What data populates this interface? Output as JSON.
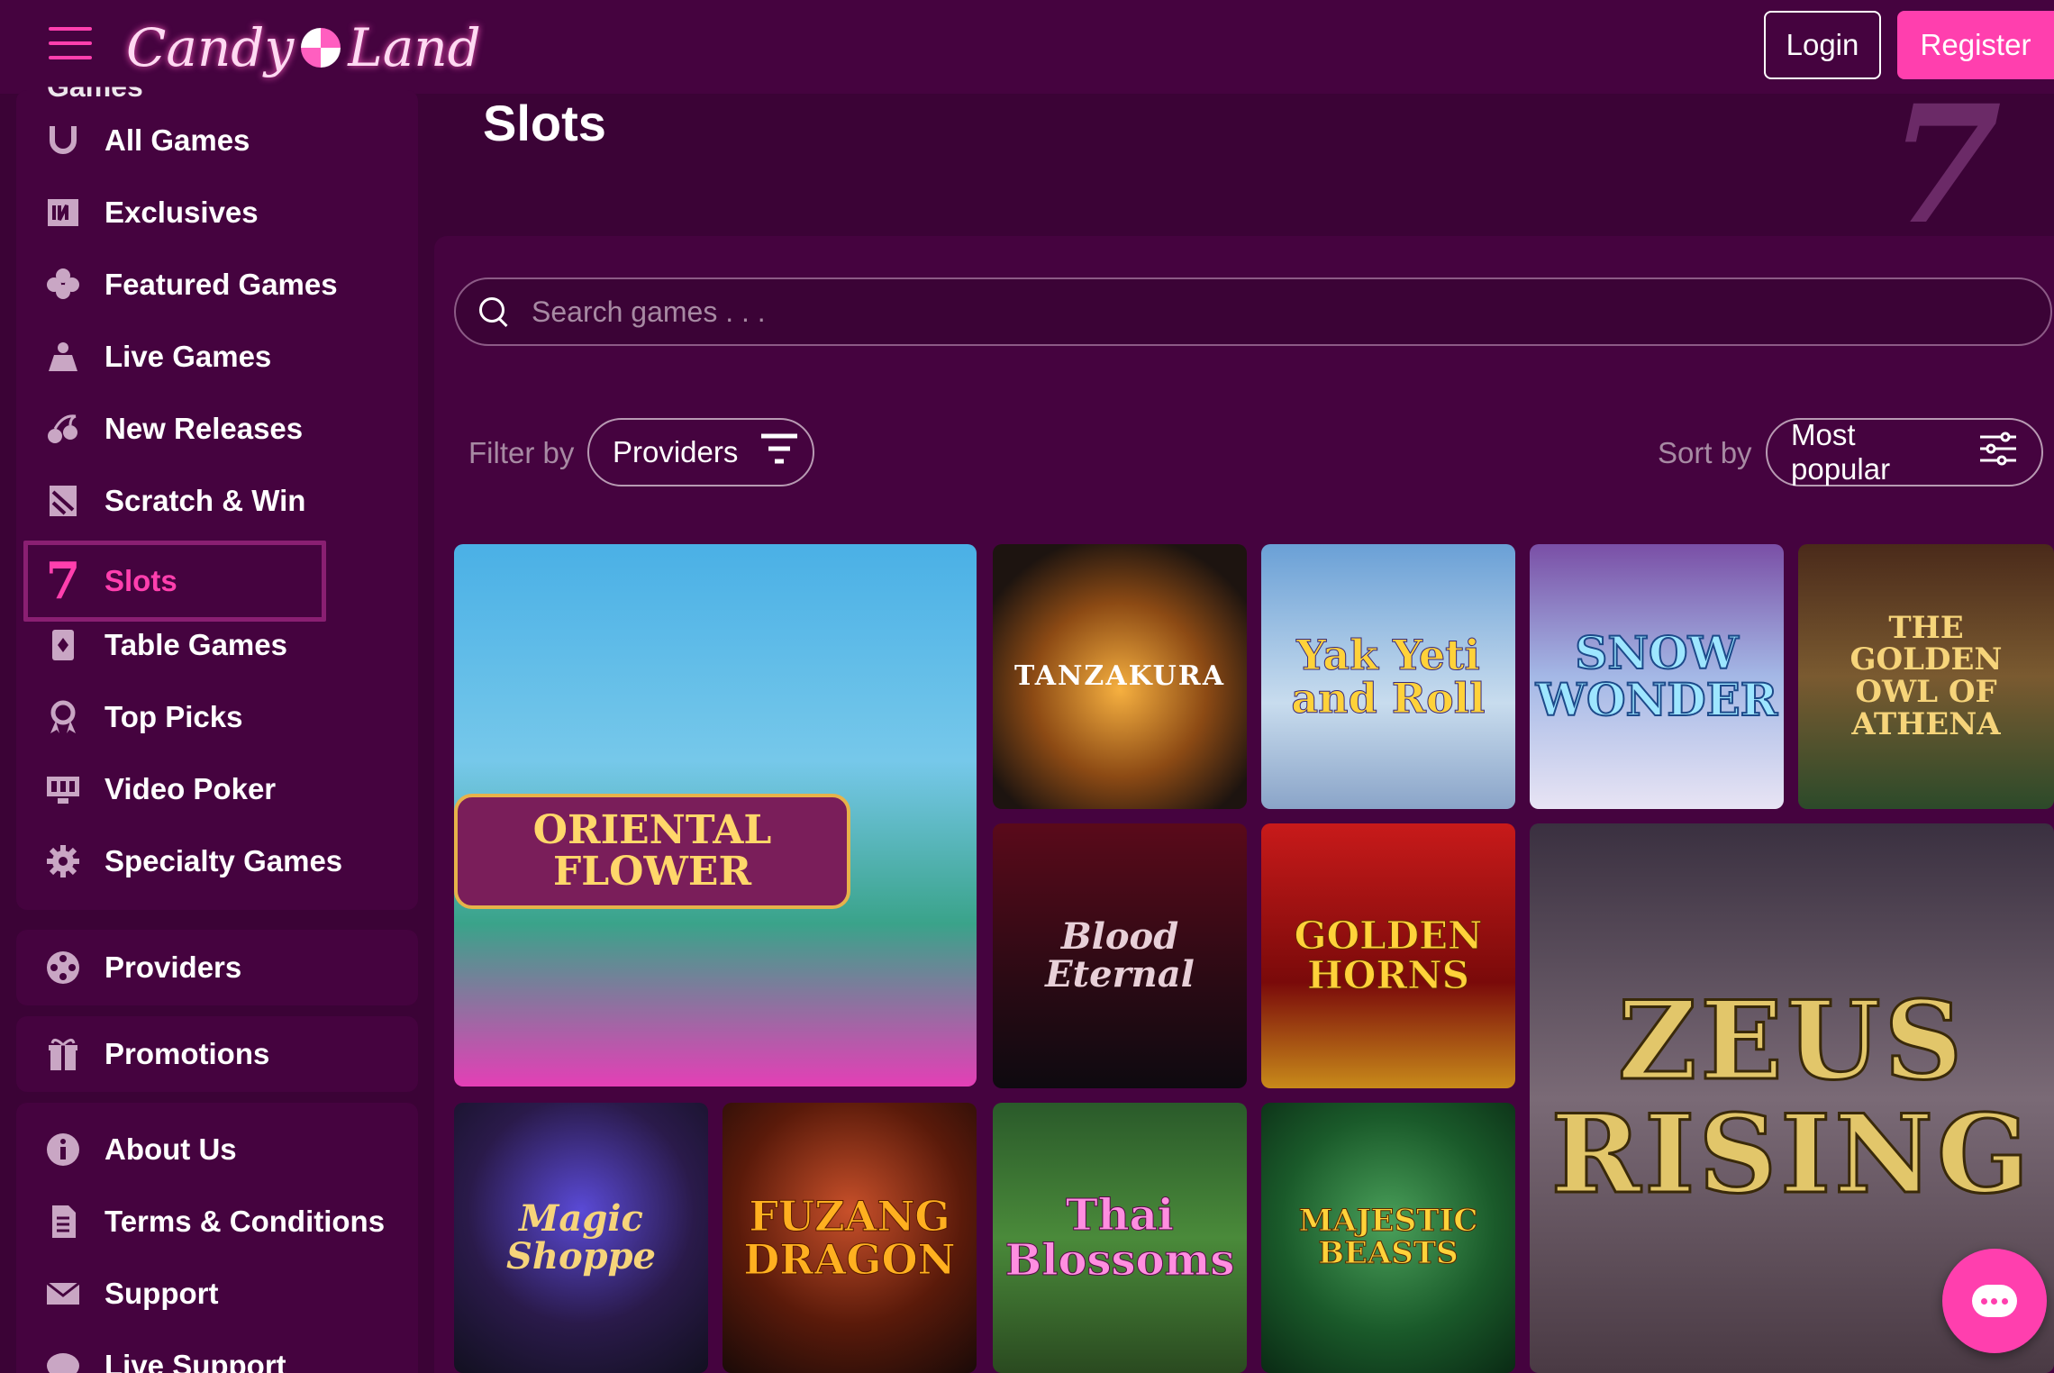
{
  "header": {
    "logo_text": "Candy Land",
    "login_label": "Login",
    "register_label": "Register"
  },
  "sidebar": {
    "section_cut_label": "Games",
    "games": [
      {
        "label": "All Games",
        "icon": "horseshoe-icon"
      },
      {
        "label": "Exclusives",
        "icon": "exclusive-badge-icon"
      },
      {
        "label": "Featured Games",
        "icon": "clover-icon"
      },
      {
        "label": "Live Games",
        "icon": "dealer-icon"
      },
      {
        "label": "New Releases",
        "icon": "cherries-icon"
      },
      {
        "label": "Scratch & Win",
        "icon": "scratch-card-icon"
      },
      {
        "label": "Slots",
        "icon": "seven-icon",
        "active": true
      },
      {
        "label": "Table Games",
        "icon": "playing-card-icon"
      },
      {
        "label": "Top Picks",
        "icon": "award-icon"
      },
      {
        "label": "Video Poker",
        "icon": "monitor-icon"
      },
      {
        "label": "Specialty Games",
        "icon": "gear-icon"
      }
    ],
    "providers_label": "Providers",
    "promotions_label": "Promotions",
    "info": [
      {
        "label": "About Us",
        "icon": "info-icon"
      },
      {
        "label": "Terms & Conditions",
        "icon": "document-icon"
      },
      {
        "label": "Support",
        "icon": "envelope-icon"
      },
      {
        "label": "Live Support",
        "icon": "chat-icon"
      }
    ]
  },
  "main": {
    "page_title": "Slots",
    "search_placeholder": "Search games . . .",
    "filter_label": "Filter by",
    "filter_value": "Providers",
    "sort_label": "Sort by",
    "sort_value": "Most popular"
  },
  "games": [
    {
      "title": "ORIENTAL FLOWER"
    },
    {
      "title": "TANZAKURA"
    },
    {
      "title": "Yak Yeti and Roll"
    },
    {
      "title": "SNOW WONDER"
    },
    {
      "title": "THE GOLDEN OWL OF ATHENA"
    },
    {
      "title": "Blood Eternal"
    },
    {
      "title": "GOLDEN HORNS"
    },
    {
      "title": "ZEUS RISING"
    },
    {
      "title": "Magic Shoppe"
    },
    {
      "title": "FUZANG DRAGON"
    },
    {
      "title": "Thai Blossoms"
    },
    {
      "title": "MAJESTIC BEASTS"
    }
  ],
  "colors": {
    "accent": "#ff3fae",
    "background": "#3b0336",
    "panel": "#45033f"
  }
}
